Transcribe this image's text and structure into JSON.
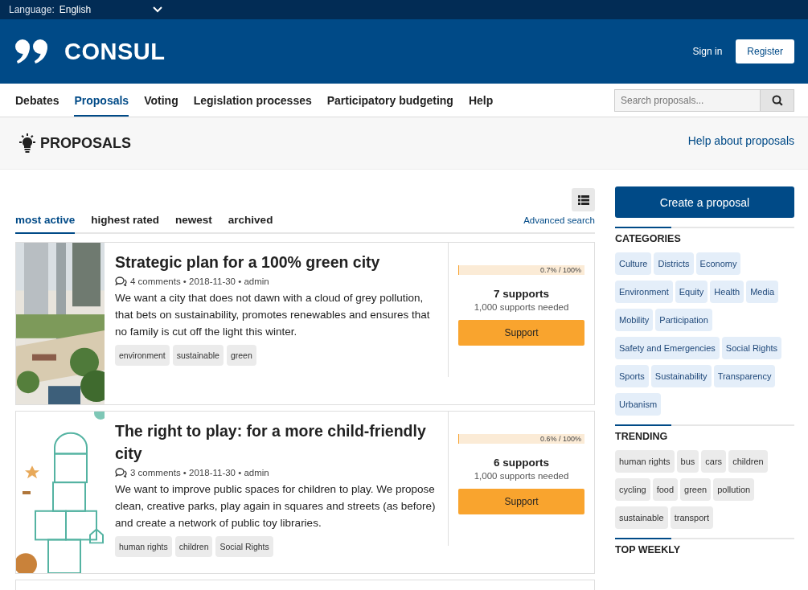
{
  "language": {
    "label": "Language:",
    "value": "English"
  },
  "header": {
    "logo_text": "CONSUL",
    "sign_in": "Sign in",
    "register": "Register"
  },
  "nav": [
    {
      "label": "Debates",
      "selected": false
    },
    {
      "label": "Proposals",
      "selected": true
    },
    {
      "label": "Voting",
      "selected": false
    },
    {
      "label": "Legislation processes",
      "selected": false
    },
    {
      "label": "Participatory budgeting",
      "selected": false
    },
    {
      "label": "Help",
      "selected": false
    }
  ],
  "search": {
    "placeholder": "Search proposals..."
  },
  "page": {
    "title": "PROPOSALS",
    "help_link": "Help about proposals"
  },
  "order_tabs": [
    {
      "label": "most active",
      "selected": true
    },
    {
      "label": "highest rated",
      "selected": false
    },
    {
      "label": "newest",
      "selected": false
    },
    {
      "label": "archived",
      "selected": false
    }
  ],
  "advanced_search": "Advanced search",
  "proposals": [
    {
      "title": "Strategic plan for a 100% green city",
      "meta": "4 comments • 2018-11-30 • admin",
      "summary": "We want a city that does not dawn with a cloud of grey pollution, that bets on sustainability, promotes renewables and ensures that no family is cut off the light this winter.",
      "tags": [
        "environment",
        "sustainable",
        "green"
      ],
      "level": 0.007,
      "progress_label": "0.7% / 100%",
      "supports": "7 supports",
      "needed": "1,000 supports needed",
      "button": "Support"
    },
    {
      "title": "The right to play: for a more child-friendly city",
      "meta": "3 comments • 2018-11-30 • admin",
      "summary": "We want to improve public spaces for children to play. We propose clean, creative parks, play again in squares and streets (as before) and create a network of public toy libraries.",
      "tags": [
        "human rights",
        "children",
        "Social Rights"
      ],
      "level": 0.006,
      "progress_label": "0.6% / 100%",
      "supports": "6 supports",
      "needed": "1,000 supports needed",
      "button": "Support"
    }
  ],
  "sidebar": {
    "create_button": "Create a proposal",
    "sections": [
      {
        "title": "CATEGORIES",
        "kind": "category",
        "tags": [
          "Culture",
          "Districts",
          "Economy",
          "Environment",
          "Equity",
          "Health",
          "Media",
          "Mobility",
          "Participation",
          "Safety and Emergencies",
          "Social Rights",
          "Sports",
          "Sustainability",
          "Transparency",
          "Urbanism"
        ]
      },
      {
        "title": "TRENDING",
        "kind": "trending",
        "tags": [
          "human rights",
          "bus",
          "cars",
          "children",
          "cycling",
          "food",
          "green",
          "pollution",
          "sustainable",
          "transport"
        ]
      },
      {
        "title": "TOP WEEKLY"
      }
    ]
  }
}
